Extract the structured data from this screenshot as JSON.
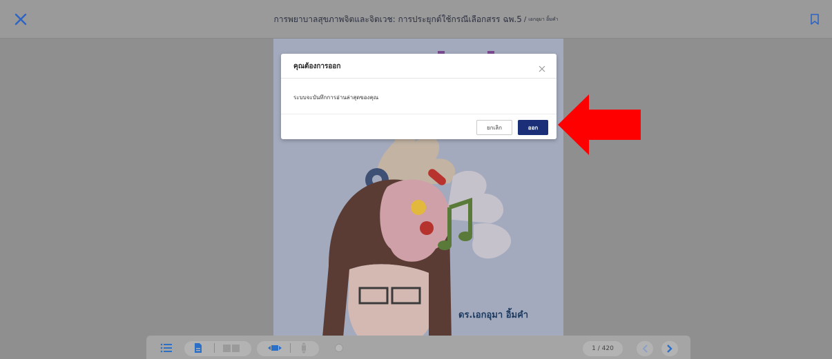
{
  "header": {
    "title": "การพยาบาลสุขภาพจิตและจิตเวช: การประยุกต์ใช้กรณีเลือกสรร ฉพ.5",
    "separator": "/",
    "author": "เอกอุมา อิ้มคำ"
  },
  "book": {
    "cover_author": "ดร.เอกอุมา อิ้มคำ"
  },
  "modal": {
    "title": "คุณต้องการออก",
    "message": "ระบบจะบันทึกการอ่านล่าสุดของคุณ",
    "cancel_label": "ยกเลิก",
    "exit_label": "ออก"
  },
  "toolbar": {
    "page_indicator": "1 / 420"
  },
  "colors": {
    "primary_button": "#1a2f78",
    "accent_icon": "#2b6fc7",
    "arrow": "#ff0000"
  }
}
